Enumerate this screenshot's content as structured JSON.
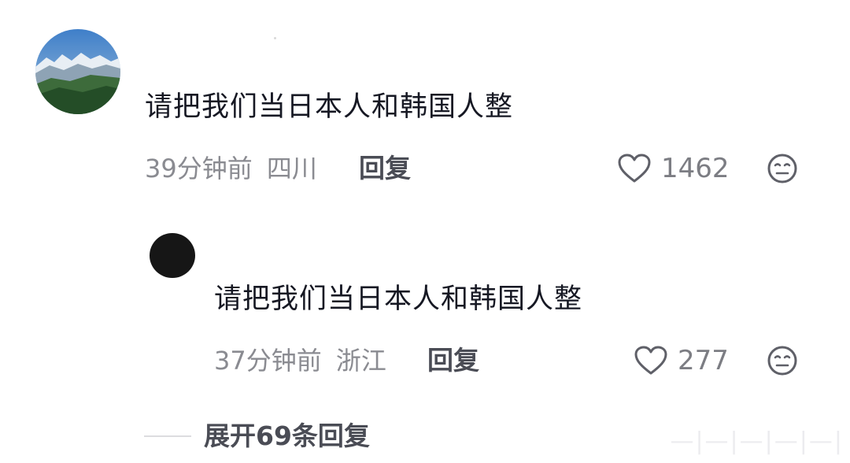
{
  "comment": {
    "avatar_icon": "mountain-landscape-avatar",
    "text": "请把我们当日本人和韩国人整",
    "time": "39分钟前",
    "location": "四川",
    "reply_label": "回复",
    "like_count": "1462"
  },
  "reply": {
    "avatar_icon": "black-circle-avatar",
    "text": "请把我们当日本人和韩国人整",
    "time": "37分钟前",
    "location": "浙江",
    "reply_label": "回复",
    "like_count": "277"
  },
  "expand": {
    "label": "展开69条回复"
  },
  "watermark": {
    "text": "—|—|—|—|—|"
  }
}
